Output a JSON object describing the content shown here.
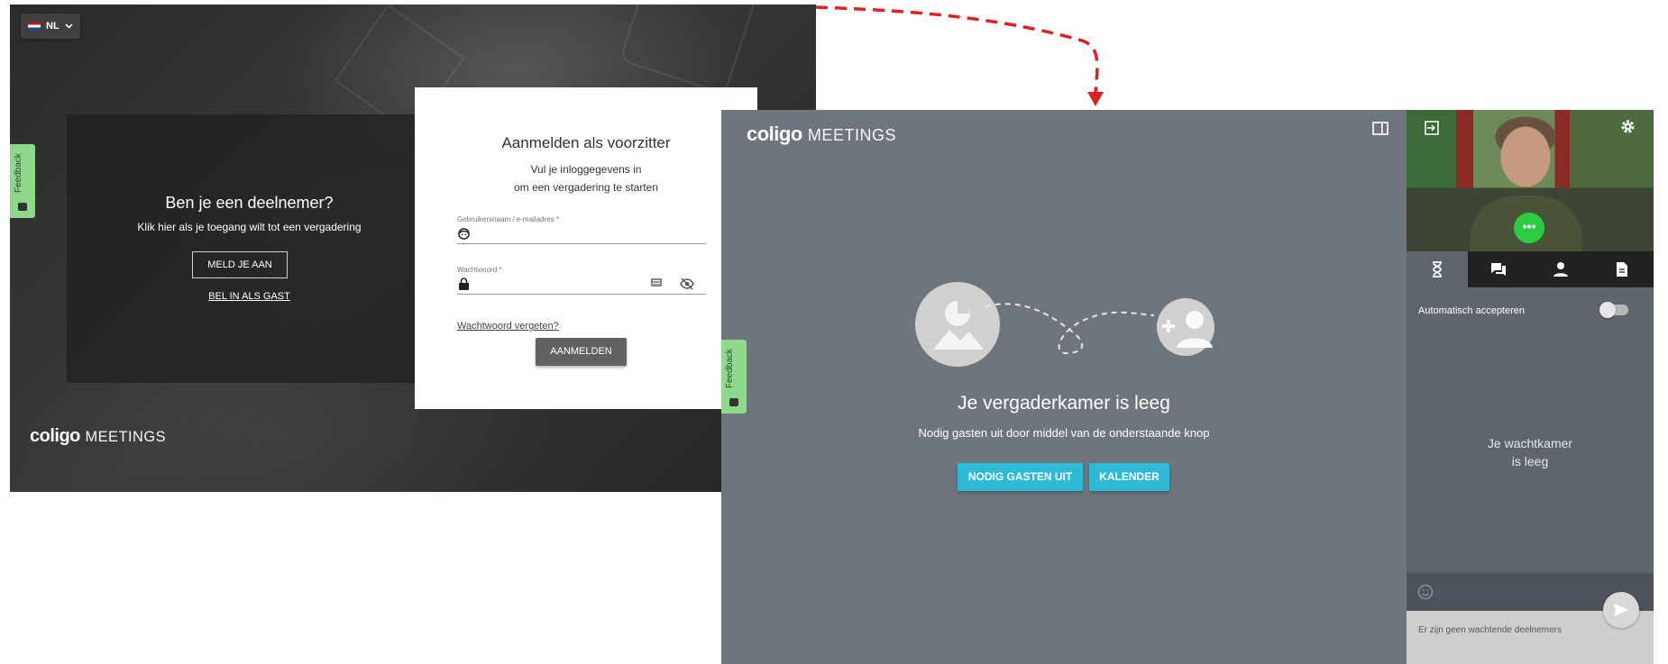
{
  "login": {
    "language": "NL",
    "participant": {
      "title": "Ben je een deelnemer?",
      "text": "Klik hier als je toegang wilt tot een vergadering",
      "join_button": "MELD JE AAN",
      "guest_link": "BEL IN ALS GAST"
    },
    "card": {
      "title": "Aanmelden als voorzitter",
      "subtitle_line1": "Vul je inloggegevens in",
      "subtitle_line2": "om een vergadering te starten",
      "username_label": "Gebruikersnaam / e-mailadres *",
      "password_label": "Wachtwoord *",
      "forgot_link": "Wachtwoord vergeten?",
      "submit_button": "AANMELDEN"
    },
    "logo": {
      "brand": "coligo",
      "product": "MEETINGS"
    },
    "feedback_label": "Feedback"
  },
  "meeting": {
    "logo": {
      "brand": "coligo",
      "product": "MEETINGS"
    },
    "feedback_label": "Feedback",
    "room_title": "Je vergaderkamer is leeg",
    "room_text": "Nodig gasten uit door middel van de onderstaande knop",
    "invite_button": "NODIG GASTEN UIT",
    "calendar_button": "KALENDER",
    "sidebar": {
      "more_button": "•••",
      "auto_accept_label": "Automatisch accepteren",
      "auto_accept_on": false,
      "waiting_line1": "Je wachtkamer",
      "waiting_line2": "is leeg",
      "no_waiting_text": "Er zijn geen wachtende deelnemers",
      "tabs": [
        "hourglass-icon",
        "chat-icon",
        "person-icon",
        "document-icon"
      ]
    }
  },
  "colors": {
    "accent": "#2dbad6",
    "feedback": "#8fd88c",
    "arrow": "#e02020",
    "meeting_bg": "#6f757d"
  }
}
